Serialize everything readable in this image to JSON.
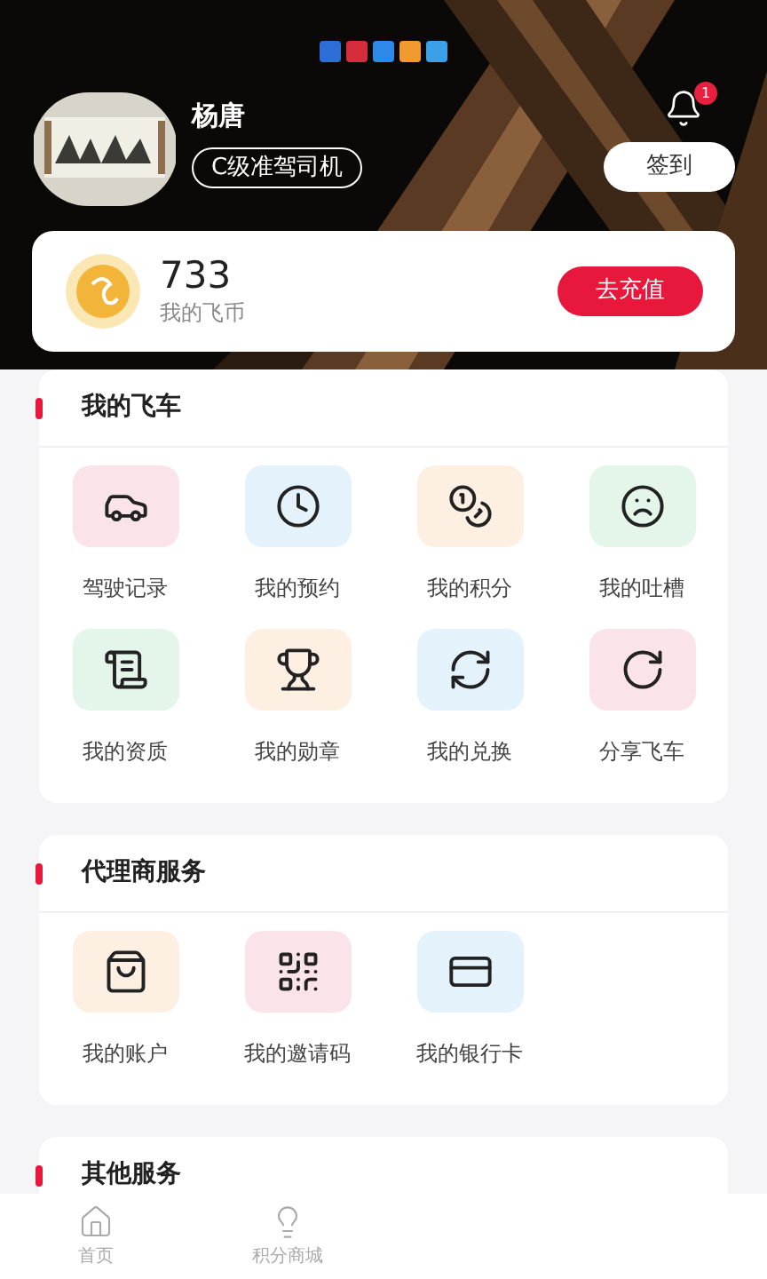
{
  "profile": {
    "name": "杨唐",
    "level_badge": "C级准驾司机",
    "notification_count": "1",
    "sign_in_button": "签到"
  },
  "coins": {
    "amount": "733",
    "label": "我的飞币",
    "recharge_button": "去充值"
  },
  "sections": [
    {
      "title": "我的飞车",
      "items": [
        {
          "label": "驾驶记录",
          "kind": "car",
          "color": "#fbe3ea"
        },
        {
          "label": "我的预约",
          "kind": "clock",
          "color": "#e3f2fb"
        },
        {
          "label": "我的积分",
          "kind": "coins",
          "color": "#fdf0e3"
        },
        {
          "label": "我的吐槽",
          "kind": "face",
          "color": "#e4f5ea"
        },
        {
          "label": "我的资质",
          "kind": "certificate",
          "color": "#e4f5ea"
        },
        {
          "label": "我的勋章",
          "kind": "trophy",
          "color": "#fdf0e3"
        },
        {
          "label": "我的兑换",
          "kind": "exchange",
          "color": "#e3f2fb"
        },
        {
          "label": "分享飞车",
          "kind": "share",
          "color": "#fbe3ea"
        }
      ]
    },
    {
      "title": "代理商服务",
      "items": [
        {
          "label": "我的账户",
          "kind": "bag",
          "color": "#fdf0e3"
        },
        {
          "label": "我的邀请码",
          "kind": "qrcode",
          "color": "#fbe3ea"
        },
        {
          "label": "我的银行卡",
          "kind": "card",
          "color": "#e3f2fb"
        }
      ]
    },
    {
      "title": "其他服务"
    }
  ],
  "tab_bar": [
    {
      "label": "首页",
      "kind": "home",
      "selected": false
    },
    {
      "label": "积分商城",
      "kind": "mall",
      "selected": false
    }
  ]
}
